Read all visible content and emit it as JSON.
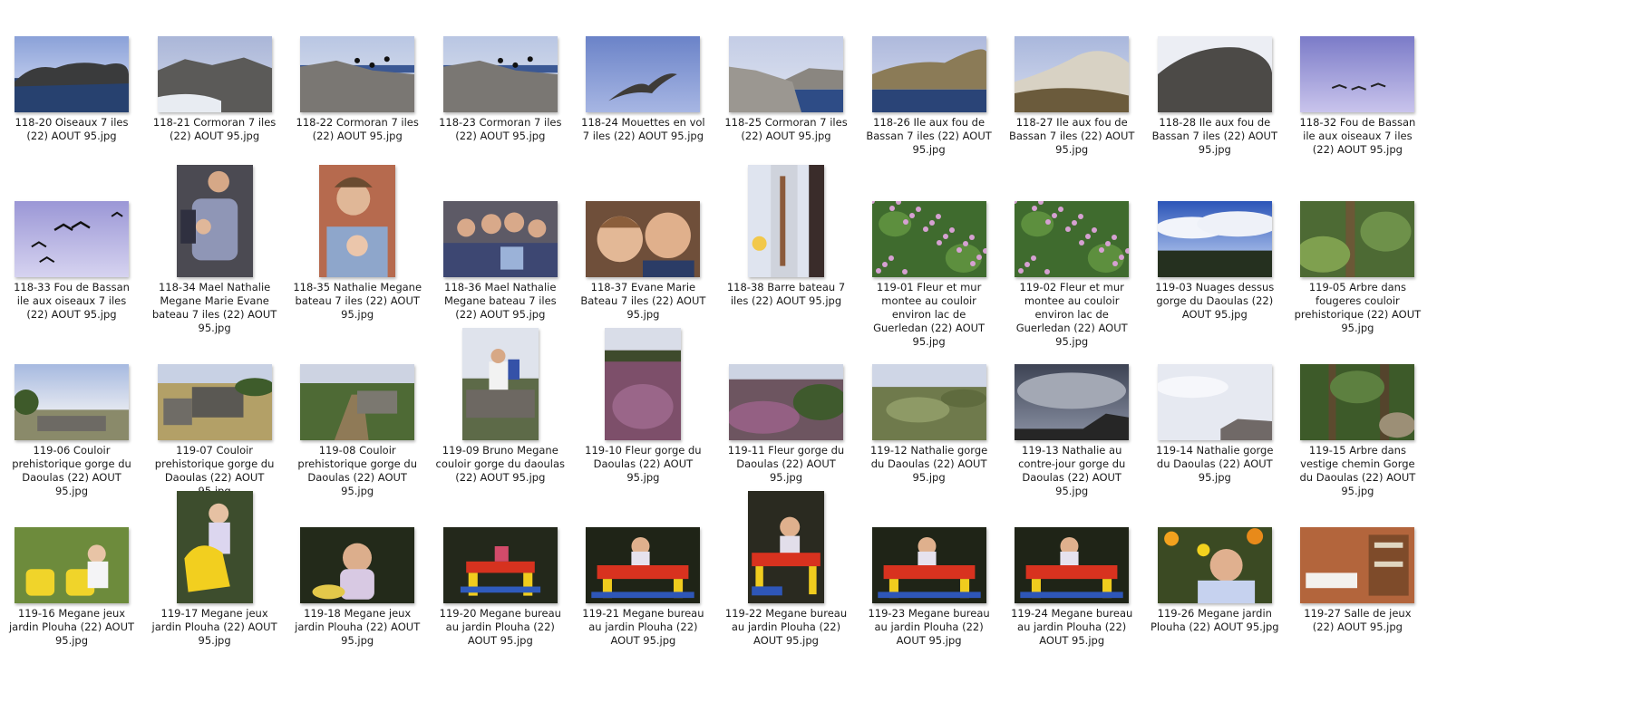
{
  "rows": [
    [
      {
        "name": "118-20 Oiseaux 7 iles (22) AOUT 95.jpg",
        "orient": "land",
        "scene": "rocks-sea"
      },
      {
        "name": "118-21 Cormoran 7 iles (22) AOUT 95.jpg",
        "orient": "land",
        "scene": "rocks-surf"
      },
      {
        "name": "118-22 Cormoran 7 iles (22) AOUT 95.jpg",
        "orient": "land",
        "scene": "rocks-birds"
      },
      {
        "name": "118-23 Cormoran 7 iles (22) AOUT 95.jpg",
        "orient": "land",
        "scene": "rocks-birds"
      },
      {
        "name": "118-24 Mouettes en vol 7 iles (22) AOUT 95.jpg",
        "orient": "land",
        "scene": "gull-sky"
      },
      {
        "name": "118-25 Cormoran 7 iles (22) AOUT 95.jpg",
        "orient": "land",
        "scene": "rocks-coast"
      },
      {
        "name": "118-26 Ile aux fou de Bassan 7 iles (22) AOUT 95.jpg",
        "orient": "land",
        "scene": "island-sea"
      },
      {
        "name": "118-27 Ile aux fou de Bassan 7 iles (22) AOUT 95.jpg",
        "orient": "land",
        "scene": "island-white"
      },
      {
        "name": "118-28 Ile aux fou de Bassan 7 iles (22) AOUT 95.jpg",
        "orient": "land",
        "scene": "island-dark"
      },
      {
        "name": "118-32 Fou de Bassan ile aux oiseaux 7 iles (22) AOUT 95.jpg",
        "orient": "land",
        "scene": "violet-sky"
      }
    ],
    [
      {
        "name": "118-33 Fou de Bassan ile aux oiseaux 7 iles (22) AOUT 95.jpg",
        "orient": "land",
        "scene": "violet-birds"
      },
      {
        "name": "118-34 Mael Nathalie Megane Marie Evane bateau 7 iles (22) AOUT 95.jpg",
        "orient": "port",
        "scene": "people-boat"
      },
      {
        "name": "118-35 Nathalie Megane bateau 7 iles (22) AOUT 95.jpg",
        "orient": "port",
        "scene": "people-close"
      },
      {
        "name": "118-36 Mael Nathalie Megane bateau 7 iles (22) AOUT 95.jpg",
        "orient": "land",
        "scene": "people-group"
      },
      {
        "name": "118-37 Evane Marie Bateau 7 iles (22) AOUT 95.jpg",
        "orient": "land",
        "scene": "people-faces"
      },
      {
        "name": "118-38 Barre bateau 7 iles (22) AOUT 95.jpg",
        "orient": "port",
        "scene": "boat-rail"
      },
      {
        "name": "119-01 Fleur et mur montee au couloir environ lac de Guerledan (22) AOUT 95.jpg",
        "orient": "land",
        "scene": "heather-green"
      },
      {
        "name": "119-02 Fleur et mur montee au couloir environ lac de Guerledan (22) AOUT 95.jpg",
        "orient": "land",
        "scene": "heather-green"
      },
      {
        "name": "119-03 Nuages dessus gorge du Daoulas (22) AOUT 95.jpg",
        "orient": "land",
        "scene": "clouds-blue"
      },
      {
        "name": "119-05 Arbre dans fougeres couloir prehistorique (22) AOUT 95.jpg",
        "orient": "land",
        "scene": "forest-green"
      }
    ],
    [
      {
        "name": "119-06 Couloir prehistorique gorge du Daoulas (22) AOUT 95.jpg",
        "orient": "land",
        "scene": "dolmen-sky"
      },
      {
        "name": "119-07 Couloir prehistorique gorge du Daoulas (22) AOUT 95.jpg",
        "orient": "land",
        "scene": "dolmen-grass"
      },
      {
        "name": "119-08 Couloir prehistorique gorge du Daoulas (22) AOUT 95.jpg",
        "orient": "land",
        "scene": "dolmen-path"
      },
      {
        "name": "119-09 Bruno Megane couloir gorge du daoulas (22) AOUT 95.jpg",
        "orient": "port",
        "scene": "man-rock"
      },
      {
        "name": "119-10 Fleur gorge du Daoulas (22) AOUT 95.jpg",
        "orient": "port",
        "scene": "heather-field"
      },
      {
        "name": "119-11 Fleur gorge du Daoulas (22) AOUT 95.jpg",
        "orient": "land",
        "scene": "heather-land"
      },
      {
        "name": "119-12 Nathalie gorge du Daoulas (22) AOUT 95.jpg",
        "orient": "land",
        "scene": "moor"
      },
      {
        "name": "119-13 Nathalie au contre-jour gorge du Daoulas (22) AOUT 95.jpg",
        "orient": "land",
        "scene": "storm"
      },
      {
        "name": "119-14 Nathalie gorge du Daoulas (22) AOUT 95.jpg",
        "orient": "land",
        "scene": "pale-sky"
      },
      {
        "name": "119-15 Arbre dans vestige chemin Gorge du Daoulas (22) AOUT 95.jpg",
        "orient": "land",
        "scene": "forest-dark"
      }
    ],
    [
      {
        "name": "119-16 Megane jeux jardin Plouha (22) AOUT 95.jpg",
        "orient": "land",
        "scene": "yellow-toy"
      },
      {
        "name": "119-17 Megane jeux jardin Plouha (22) AOUT 95.jpg",
        "orient": "port",
        "scene": "yellow-horse"
      },
      {
        "name": "119-18 Megane jeux jardin Plouha (22) AOUT 95.jpg",
        "orient": "land",
        "scene": "baby-dark"
      },
      {
        "name": "119-20 Megane bureau au jardin Plouha (22) AOUT 95.jpg",
        "orient": "land",
        "scene": "desk"
      },
      {
        "name": "119-21 Megane bureau au jardin Plouha (22) AOUT 95.jpg",
        "orient": "land",
        "scene": "desk-baby"
      },
      {
        "name": "119-22 Megane bureau au jardin Plouha (22) AOUT 95.jpg",
        "orient": "port",
        "scene": "desk-port"
      },
      {
        "name": "119-23 Megane bureau au jardin Plouha (22) AOUT 95.jpg",
        "orient": "land",
        "scene": "desk-baby"
      },
      {
        "name": "119-24 Megane bureau au jardin Plouha (22) AOUT 95.jpg",
        "orient": "land",
        "scene": "desk-baby"
      },
      {
        "name": "119-26 Megane jardin Plouha (22) AOUT 95.jpg",
        "orient": "land",
        "scene": "baby-flowers"
      },
      {
        "name": "119-27 Salle de jeux (22) AOUT 95.jpg",
        "orient": "land",
        "scene": "playroom"
      }
    ]
  ]
}
